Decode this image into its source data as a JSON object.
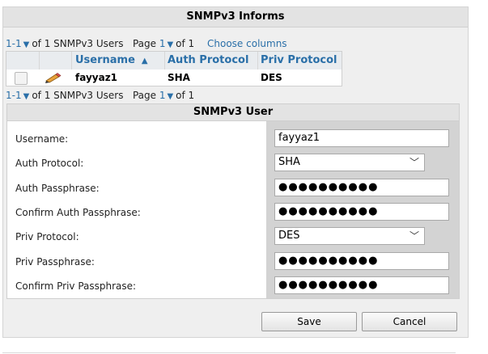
{
  "panel": {
    "title": "SNMPv3 Informs"
  },
  "pager_top": {
    "range": "1-1",
    "of_text": "of 1 SNMPv3 Users",
    "page_label": "Page",
    "page_num": "1",
    "of_pages": "of 1",
    "choose_columns": "Choose columns"
  },
  "table": {
    "columns": {
      "username": "Username",
      "auth": "Auth Protocol",
      "priv": "Priv Protocol"
    },
    "rows": [
      {
        "username": "fayyaz1",
        "auth": "SHA",
        "priv": "DES"
      }
    ]
  },
  "pager_bottom": {
    "range": "1-1",
    "of_text": "of 1 SNMPv3 Users",
    "page_label": "Page",
    "page_num": "1",
    "of_pages": "of 1"
  },
  "user_form": {
    "title": "SNMPv3 User",
    "username_label": "Username:",
    "username_value": "fayyaz1",
    "auth_protocol_label": "Auth Protocol:",
    "auth_protocol_value": "SHA",
    "auth_pass_label": "Auth Passphrase:",
    "auth_pass_value": "●●●●●●●●●●",
    "confirm_auth_label": "Confirm Auth Passphrase:",
    "confirm_auth_value": "●●●●●●●●●●",
    "priv_protocol_label": "Priv Protocol:",
    "priv_protocol_value": "DES",
    "priv_pass_label": "Priv Passphrase:",
    "priv_pass_value": "●●●●●●●●●●",
    "confirm_priv_label": "Confirm Priv Passphrase:",
    "confirm_priv_value": "●●●●●●●●●●"
  },
  "buttons": {
    "save": "Save",
    "cancel": "Cancel"
  },
  "colors": {
    "link": "#2a6fa8",
    "panel_bg": "#efefef",
    "value_col_bg": "#d3d3d3"
  }
}
